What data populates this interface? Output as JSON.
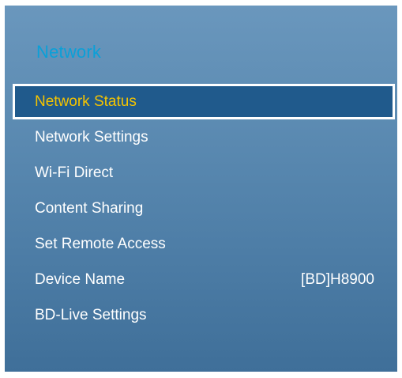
{
  "menu": {
    "title": "Network",
    "items": [
      {
        "label": "Network Status",
        "value": ""
      },
      {
        "label": "Network Settings",
        "value": ""
      },
      {
        "label": "Wi-Fi Direct",
        "value": ""
      },
      {
        "label": "Content Sharing",
        "value": ""
      },
      {
        "label": "Set Remote Access",
        "value": ""
      },
      {
        "label": "Device Name",
        "value": "[BD]H8900"
      },
      {
        "label": "BD-Live Settings",
        "value": ""
      }
    ],
    "selected_index": 0
  },
  "colors": {
    "title": "#0aa0d8",
    "selected_text": "#f5c400",
    "selected_background": "#205a8c",
    "item_text": "#ffffff"
  }
}
